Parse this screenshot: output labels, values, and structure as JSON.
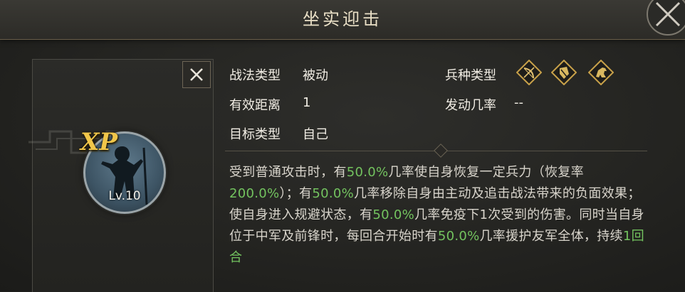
{
  "title": "坐实迎击",
  "card": {
    "xp_label": "XP",
    "level": "Lv.10"
  },
  "info": {
    "tactic_type_label": "战法类型",
    "tactic_type_value": "被动",
    "range_label": "有效距离",
    "range_value": "1",
    "target_label": "目标类型",
    "target_value": "自己",
    "troop_type_label": "兵种类型",
    "troop_icons": [
      "archer-icon",
      "shield-infantry-icon",
      "horse-cavalry-icon"
    ],
    "trigger_rate_label": "发动几率",
    "trigger_rate_value": "--"
  },
  "description": {
    "p1": "受到普通攻击时，有",
    "h1": "50.0%",
    "p2": "几率使自身恢复一定兵力（恢复率",
    "h2": "200.0%",
    "p3": "）；有",
    "h3": "50.0%",
    "p4": "几率移除自身由主动及追击战法带来的负面效果；使自身进入规避状态，有",
    "h4": "50.0%",
    "p5": "几率免疫下1次受到的伤害。同时当自身位于中军及前锋时，每回合开始时有",
    "h5": "50.0%",
    "p6": "几率援护友军全体，持续",
    "h6": "1回合"
  },
  "colors": {
    "highlight": "#73c35f",
    "gold": "#f0c64a",
    "icon_gold": "#c9a24a"
  }
}
